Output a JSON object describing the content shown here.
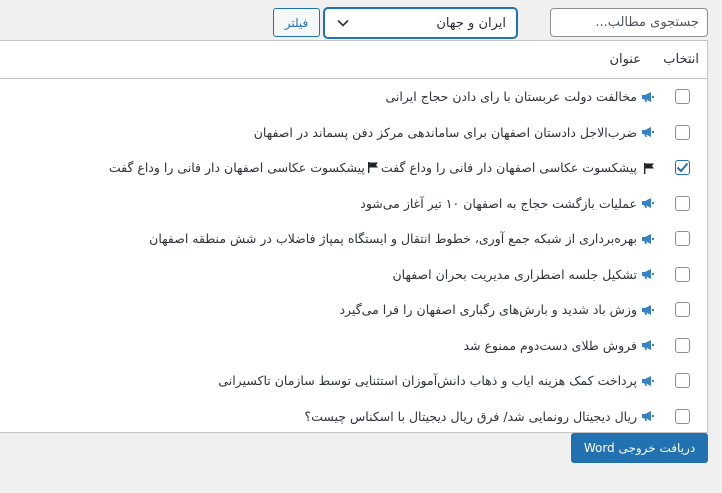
{
  "toolbar": {
    "search_placeholder": "جستجوی مطالب...",
    "category_selected": "ایران و جهان",
    "filter_label": "فیلتر"
  },
  "table": {
    "col_select": "انتخاب",
    "col_title": "عنوان",
    "rows": [
      {
        "icon": "megaphone-icon",
        "title": "مخالفت دولت عربستان با رای دادن حجاج ایرانی",
        "checked": false
      },
      {
        "icon": "megaphone-icon",
        "title": "ضرب‌الاجل دادستان اصفهان برای ساماندهی مرکز دفن پسماند در اصفهان",
        "checked": false
      },
      {
        "icon": "flag-icon",
        "title_a": "پیشکسوت عکاسی اصفهان دار فانی را وداع گفت",
        "title_b": "پیشکسوت عکاسی اصفهان دار فانی را وداع گفت",
        "checked": true
      },
      {
        "icon": "megaphone-icon",
        "title": "عملیات بازگشت حجاج به اصفهان ۱۰ تیر آغاز می‌شود",
        "checked": false
      },
      {
        "icon": "megaphone-icon",
        "title": "بهره‌برداری از شبکه جمع آوری، خطوط انتقال و ایستگاه پمپاژ فاضلاب در شش منطقه اصفهان",
        "checked": false
      },
      {
        "icon": "megaphone-icon",
        "title": "تشکیل جلسه اضطراری مدیریت بحران اصفهان",
        "checked": false
      },
      {
        "icon": "megaphone-icon",
        "title": "وزش باد شدید و بارش‌های رگباری اصفهان را فرا می‌گیرد",
        "checked": false
      },
      {
        "icon": "megaphone-icon",
        "title": "فروش طلای دست‌دوم ممنوع شد",
        "checked": false
      },
      {
        "icon": "megaphone-icon",
        "title": "پرداخت کمک هزینه ایاب و ذهاب دانش‌آموزان استثنایی توسط سازمان تاکسیرانی",
        "checked": false
      },
      {
        "icon": "megaphone-icon",
        "title": "ریال دیجیتال رونمایی شد/ فرق ریال دیجیتال با اسکناس چیست؟",
        "checked": false
      }
    ]
  },
  "export_label": "دریافت خروجی Word",
  "colors": {
    "accent": "#2271b1",
    "megaphone": "#3582c4",
    "background": "#f0f0f1"
  }
}
